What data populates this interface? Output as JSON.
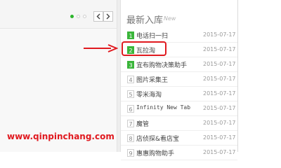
{
  "panel": {
    "title": "最新入库",
    "subtitle": "New"
  },
  "items": [
    {
      "rank": "1",
      "name": "电话扫一扫",
      "date": "2015-07-17"
    },
    {
      "rank": "2",
      "name": "瓦拉淘",
      "date": "2015-07-17"
    },
    {
      "rank": "3",
      "name": "宜布购物决策助手",
      "date": "2015-07-17"
    },
    {
      "rank": "4",
      "name": "图片采集王",
      "date": "2015-07-17"
    },
    {
      "rank": "5",
      "name": "零米海淘",
      "date": "2015-07-17"
    },
    {
      "rank": "6",
      "name": "Infinity New Tab",
      "date": "2015-07-17"
    },
    {
      "rank": "7",
      "name": "魔管",
      "date": "2015-07-17"
    },
    {
      "rank": "8",
      "name": "店侦探&看店宝",
      "date": "2015-07-17"
    },
    {
      "rank": "9",
      "name": "惠惠购物助手",
      "date": "2015-07-17"
    }
  ],
  "hot_rank_color": "#3ab53a",
  "annotation_color": "#e0191f",
  "watermark": "www.qinpinchang.com",
  "icons": {
    "prev": "chevron-left-icon",
    "next": "chevron-right-icon",
    "pointer": "arrow-right-icon"
  }
}
